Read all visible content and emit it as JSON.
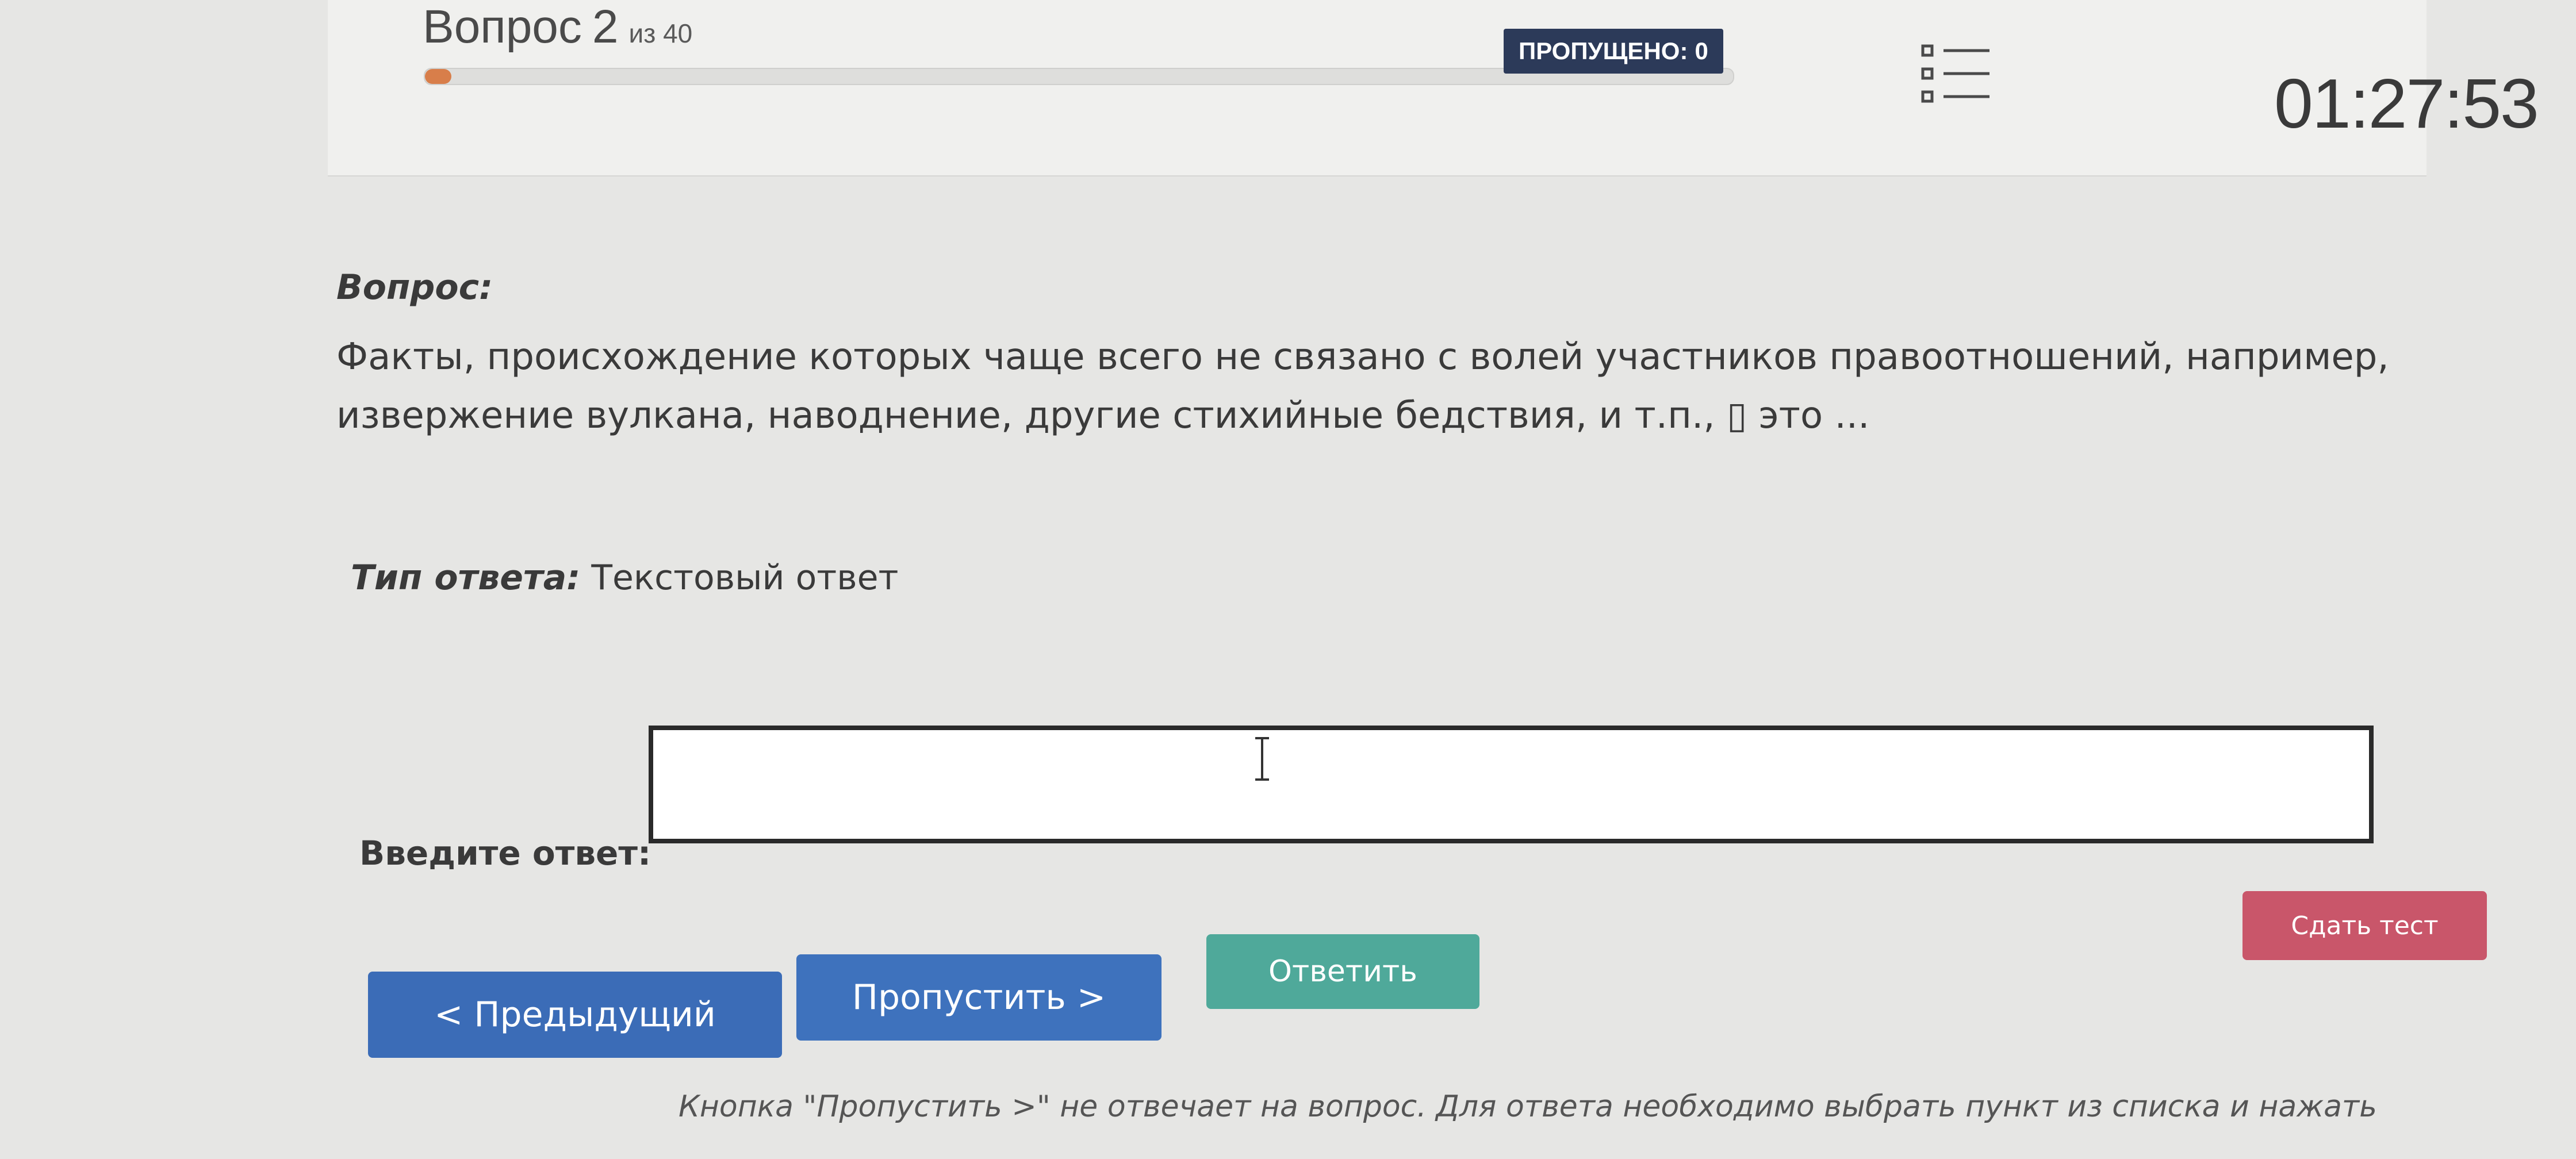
{
  "header": {
    "question_word": "Вопрос",
    "current_question": "2",
    "of_total": "из 40",
    "progress_fraction": 0.02,
    "skipped_label": "ПРОПУЩЕНО:",
    "skipped_count": "0",
    "timer": "01:27:53"
  },
  "question": {
    "label": "Вопрос:",
    "text": "Факты, происхождение которых чаще всего не связано с волей участников правоотношений, например, извержение вулкана, наводнение, другие стихийные бедствия, и т.п., ▯ это ..."
  },
  "answer_type": {
    "label": "Тип ответа:",
    "value": "Текстовый ответ"
  },
  "answer_input": {
    "label": "Введите ответ:",
    "value": "",
    "placeholder": ""
  },
  "buttons": {
    "prev": "< Предыдущий",
    "skip": "Пропустить >",
    "answer": "Ответить",
    "submit": "Сдать тест"
  },
  "hint": "Кнопка \"Пропустить >\" не отвечает на вопрос. Для ответа необходимо выбрать пункт из списка и нажать",
  "colors": {
    "accent_blue": "#3b6cb7",
    "answer_teal": "#4fa99a",
    "submit_red": "#c9566a",
    "badge_navy": "#2c3a59",
    "progress_orange": "#d87e4a"
  },
  "icons": {
    "list": "list-icon",
    "cursor": "text-cursor-icon"
  }
}
